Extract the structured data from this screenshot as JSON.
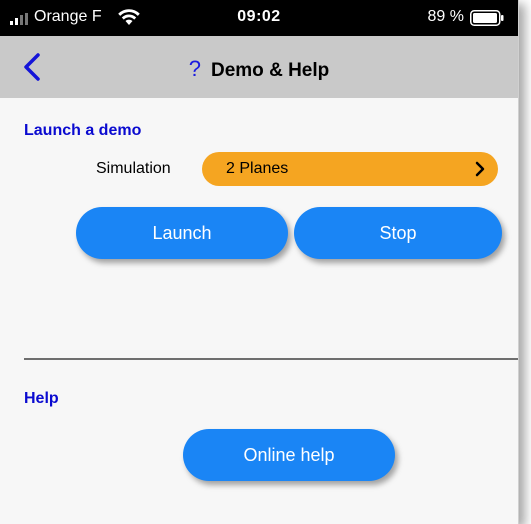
{
  "status_bar": {
    "carrier": "Orange F",
    "time": "09:02",
    "battery_percent": "89 %"
  },
  "nav": {
    "title_icon": "?",
    "title": "Demo & Help"
  },
  "demo": {
    "section_title": "Launch a demo",
    "simulation_label": "Simulation",
    "simulation_value": "2 Planes",
    "launch_label": "Launch",
    "stop_label": "Stop"
  },
  "help": {
    "section_title": "Help",
    "online_help_label": "Online help"
  },
  "colors": {
    "accent_blue": "#1a85f5",
    "title_blue": "#0a0ad0",
    "select_orange": "#f5a521",
    "nav_gray": "#c9c9c9"
  }
}
